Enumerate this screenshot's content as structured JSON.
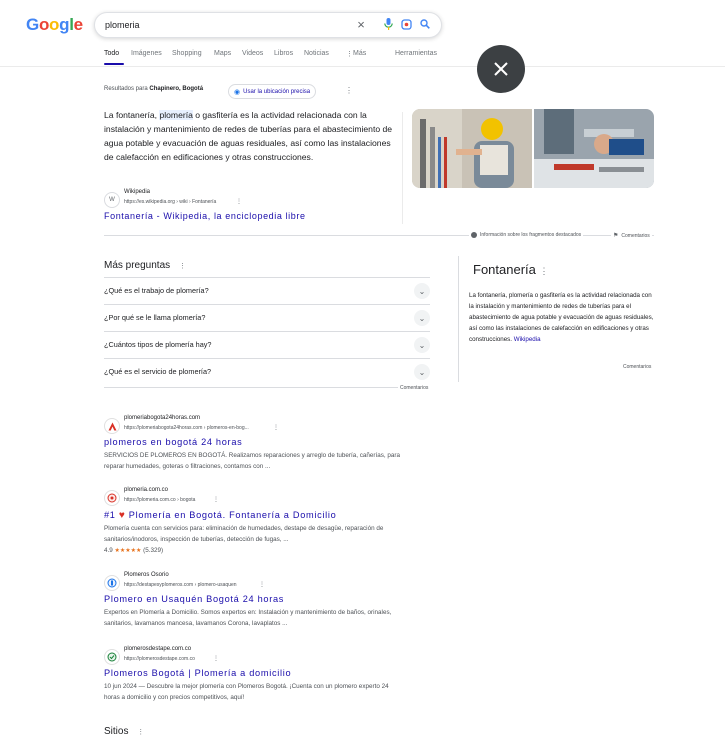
{
  "logo": {
    "letters": [
      "G",
      "o",
      "o",
      "g",
      "l",
      "e"
    ],
    "colors": [
      "#4285f4",
      "#ea4335",
      "#fbbc05",
      "#4285f4",
      "#34a853",
      "#ea4335"
    ]
  },
  "search": {
    "value": "plomeria"
  },
  "tabs": [
    {
      "label": "Todo",
      "active": true
    },
    {
      "label": "Imágenes"
    },
    {
      "label": "Shopping"
    },
    {
      "label": "Maps"
    },
    {
      "label": "Videos"
    },
    {
      "label": "Libros"
    },
    {
      "label": "Noticias"
    },
    {
      "label": "Más"
    },
    {
      "label": "Herramientas"
    }
  ],
  "location": {
    "prefix": "Resultados para",
    "place": "Chapinero, Bogotá",
    "button": "Usar la ubicación precisa"
  },
  "featured": {
    "text_before": "La fontanería, ",
    "highlight": "plomería",
    "text_after": " o gasfitería es la actividad relacionada con la instalación y mantenimiento de redes de tuberías para el abastecimiento de agua potable y evacuación de aguas residuales, así como las instalaciones de calefacción en edificaciones y otras construcciones.",
    "source_name": "Wikipedia",
    "source_url": "https://es.wikipedia.org › wiki › Fontanería",
    "title": "Fontanería - Wikipedia, la enciclopedia libre",
    "about": "Información sobre los fragmentos destacados",
    "feedback": "Comentarios"
  },
  "paa": {
    "heading": "Más preguntas",
    "questions": [
      "¿Qué es el trabajo de plomería?",
      "¿Por qué se le llama plomería?",
      "¿Cuántos tipos de plomería hay?",
      "¿Qué es el servicio de plomería?"
    ],
    "feedback": "Comentarios"
  },
  "knowledge_panel": {
    "title": "Fontanería",
    "description": "La fontanería, plomería o gasfitería es la actividad relacionada con la instalación y mantenimiento de redes de tuberías para el abastecimiento de agua potable y evacuación de aguas residuales, así como las instalaciones de calefacción en edificaciones y otras construcciones.",
    "source": "Wikipedia",
    "feedback": "Comentarios"
  },
  "results": [
    {
      "site": "plomeriabogota24horas.com",
      "url": "https://plomeriabogota24horas.com › plomeros-en-bog...",
      "title": "plomeros en bogotá 24 horas",
      "desc": "SERVICIOS DE PLOMEROS EN BOGOTÁ. Realizamos reparaciones y arreglo de tubería, cañerías, para reparar humedades, goteras o filtraciones, contamos con ..."
    },
    {
      "site": "plomeria.com.co",
      "url": "https://plomeria.com.co › bogota",
      "title_prefix": "#1",
      "title": "Plomería en Bogotá. Fontanería a Domicilio",
      "desc": "Plomería cuenta con servicios para: eliminación de humedades, destape de desagüe, reparación de sanitarios/inodoros, inspección de tuberías, detección de fugas, ...",
      "rating": "4.9",
      "stars": "★★★★★",
      "reviews": "(5.329)"
    },
    {
      "site": "Plomeros Osorio",
      "url": "https://destapesyplomeros.com › plomero-usaquen",
      "title": "Plomero en Usaquén Bogotá 24 horas",
      "desc": "Expertos en Plomería a Domicilio. Somos expertos en: Instalación y mantenimiento de baños, orinales, sanitarios, lavamanos mancesa, lavamanos Corona, lavaplatos ..."
    },
    {
      "site": "plomerosdestape.com.co",
      "url": "https://plomerosdestape.com.co",
      "title": "Plomeros Bogotá | Plomería a domicilio",
      "desc": "10 jun 2024 — Descubre la mejor plomería con Plomeros Bogotá. ¡Cuenta con un plomero experto 24 horas a domicilio y con precios competitivos, aquí!"
    }
  ],
  "sites_heading": "Sitios"
}
